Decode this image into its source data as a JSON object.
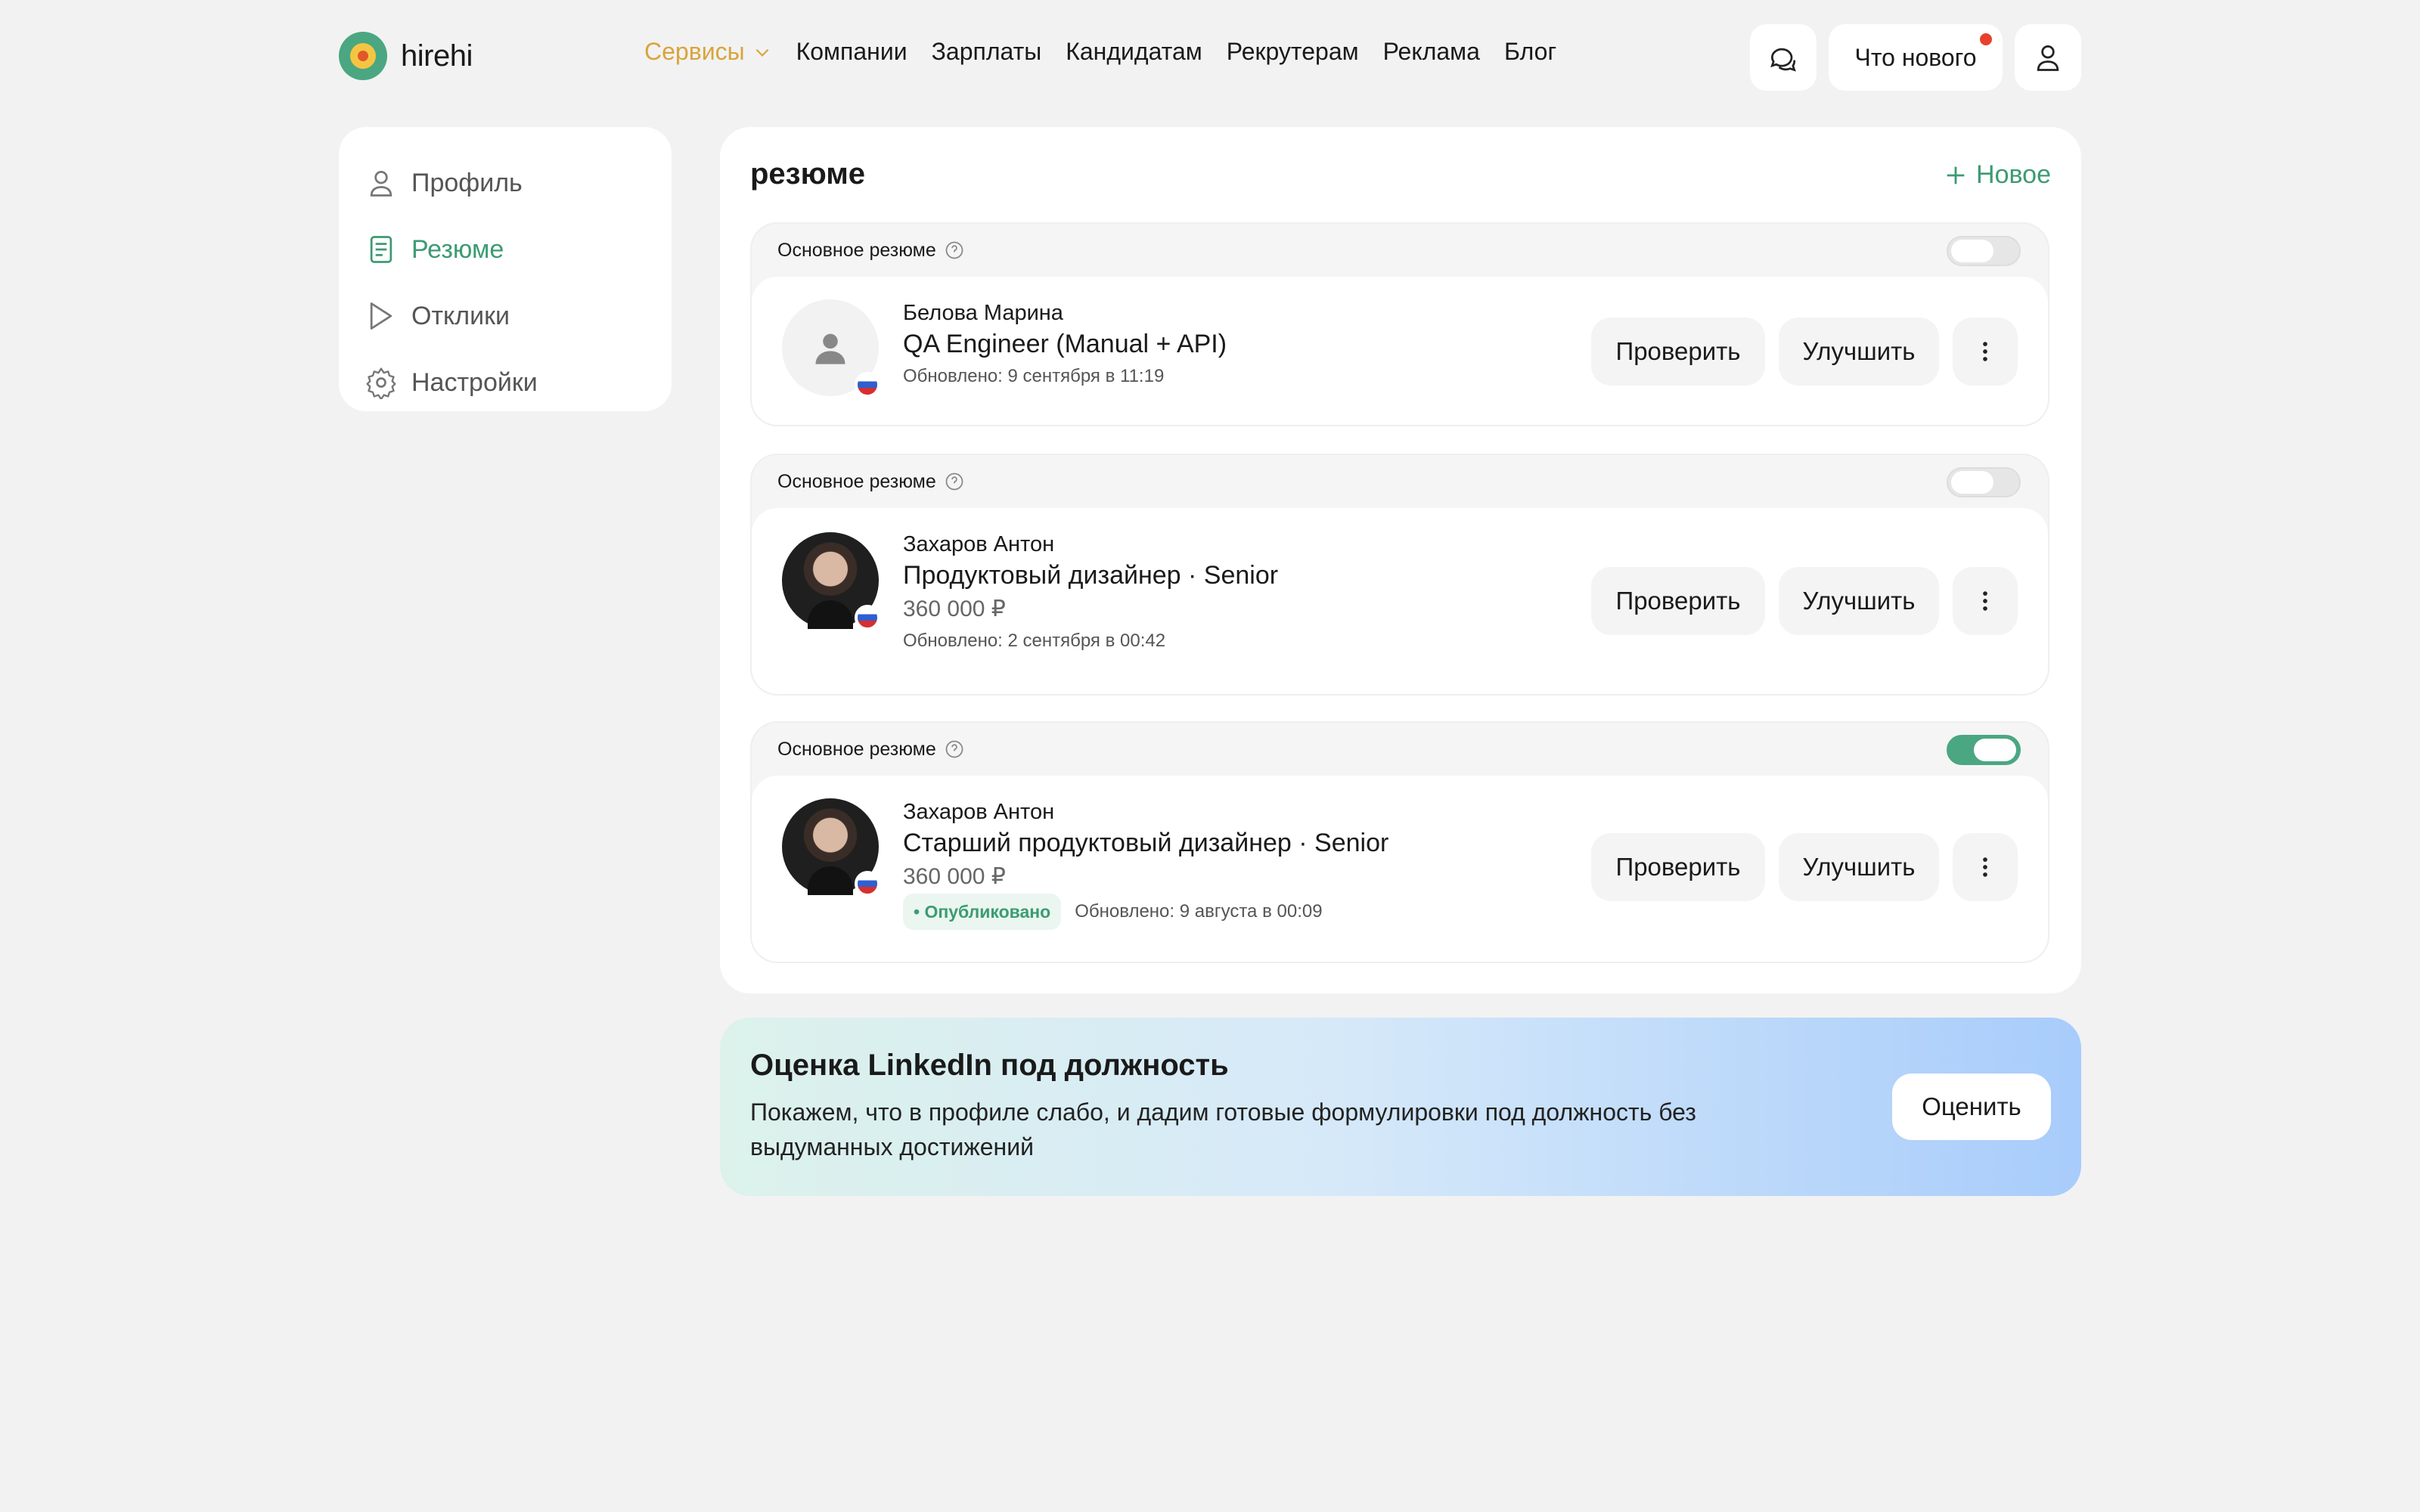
{
  "brand": {
    "name": "hirehi"
  },
  "nav": {
    "services": "Сервисы",
    "items": [
      "Компании",
      "Зарплаты",
      "Кандидатам",
      "Рекрутерам",
      "Реклама",
      "Блог"
    ]
  },
  "header": {
    "whats_new": "Что нового"
  },
  "sidebar": {
    "items": [
      {
        "label": "Профиль",
        "icon": "user-icon"
      },
      {
        "label": "Резюме",
        "icon": "document-icon",
        "active": true
      },
      {
        "label": "Отклики",
        "icon": "cursor-icon"
      },
      {
        "label": "Настройки",
        "icon": "gear-icon"
      }
    ]
  },
  "main": {
    "title": "резюме",
    "new_label": "Новое",
    "resumes": [
      {
        "primary_label": "Основное резюме",
        "primary_on": false,
        "name": "Белова Марина",
        "role": "QA Engineer (Manual + API)",
        "salary": "",
        "status": "",
        "updated": "Обновлено: 9 сентября в 11:19",
        "avatar": "placeholder",
        "check": "Проверить",
        "improve": "Улучшить"
      },
      {
        "primary_label": "Основное резюме",
        "primary_on": false,
        "name": "Захаров Антон",
        "role": "Продуктовый дизайнер · Senior",
        "salary": "360 000 ₽",
        "status": "",
        "updated": "Обновлено: 2 сентября в 00:42",
        "avatar": "photo",
        "check": "Проверить",
        "improve": "Улучшить"
      },
      {
        "primary_label": "Основное резюме",
        "primary_on": true,
        "name": "Захаров Антон",
        "role": "Старший продуктовый дизайнер · Senior",
        "salary": "360 000 ₽",
        "status": "• Опубликовано",
        "updated": "Обновлено: 9 августа в 00:09",
        "avatar": "photo",
        "check": "Проверить",
        "improve": "Улучшить"
      }
    ]
  },
  "promo": {
    "title": "Оценка LinkedIn под должность",
    "description": "Покажем, что в профиле слабо, и дадим готовые формулировки под должность без выдуманных достижений",
    "button": "Оценить"
  },
  "colors": {
    "accent": "#3c9b72",
    "services": "#d9a43a",
    "background": "#f2f2f2",
    "notification": "#e8412b"
  }
}
